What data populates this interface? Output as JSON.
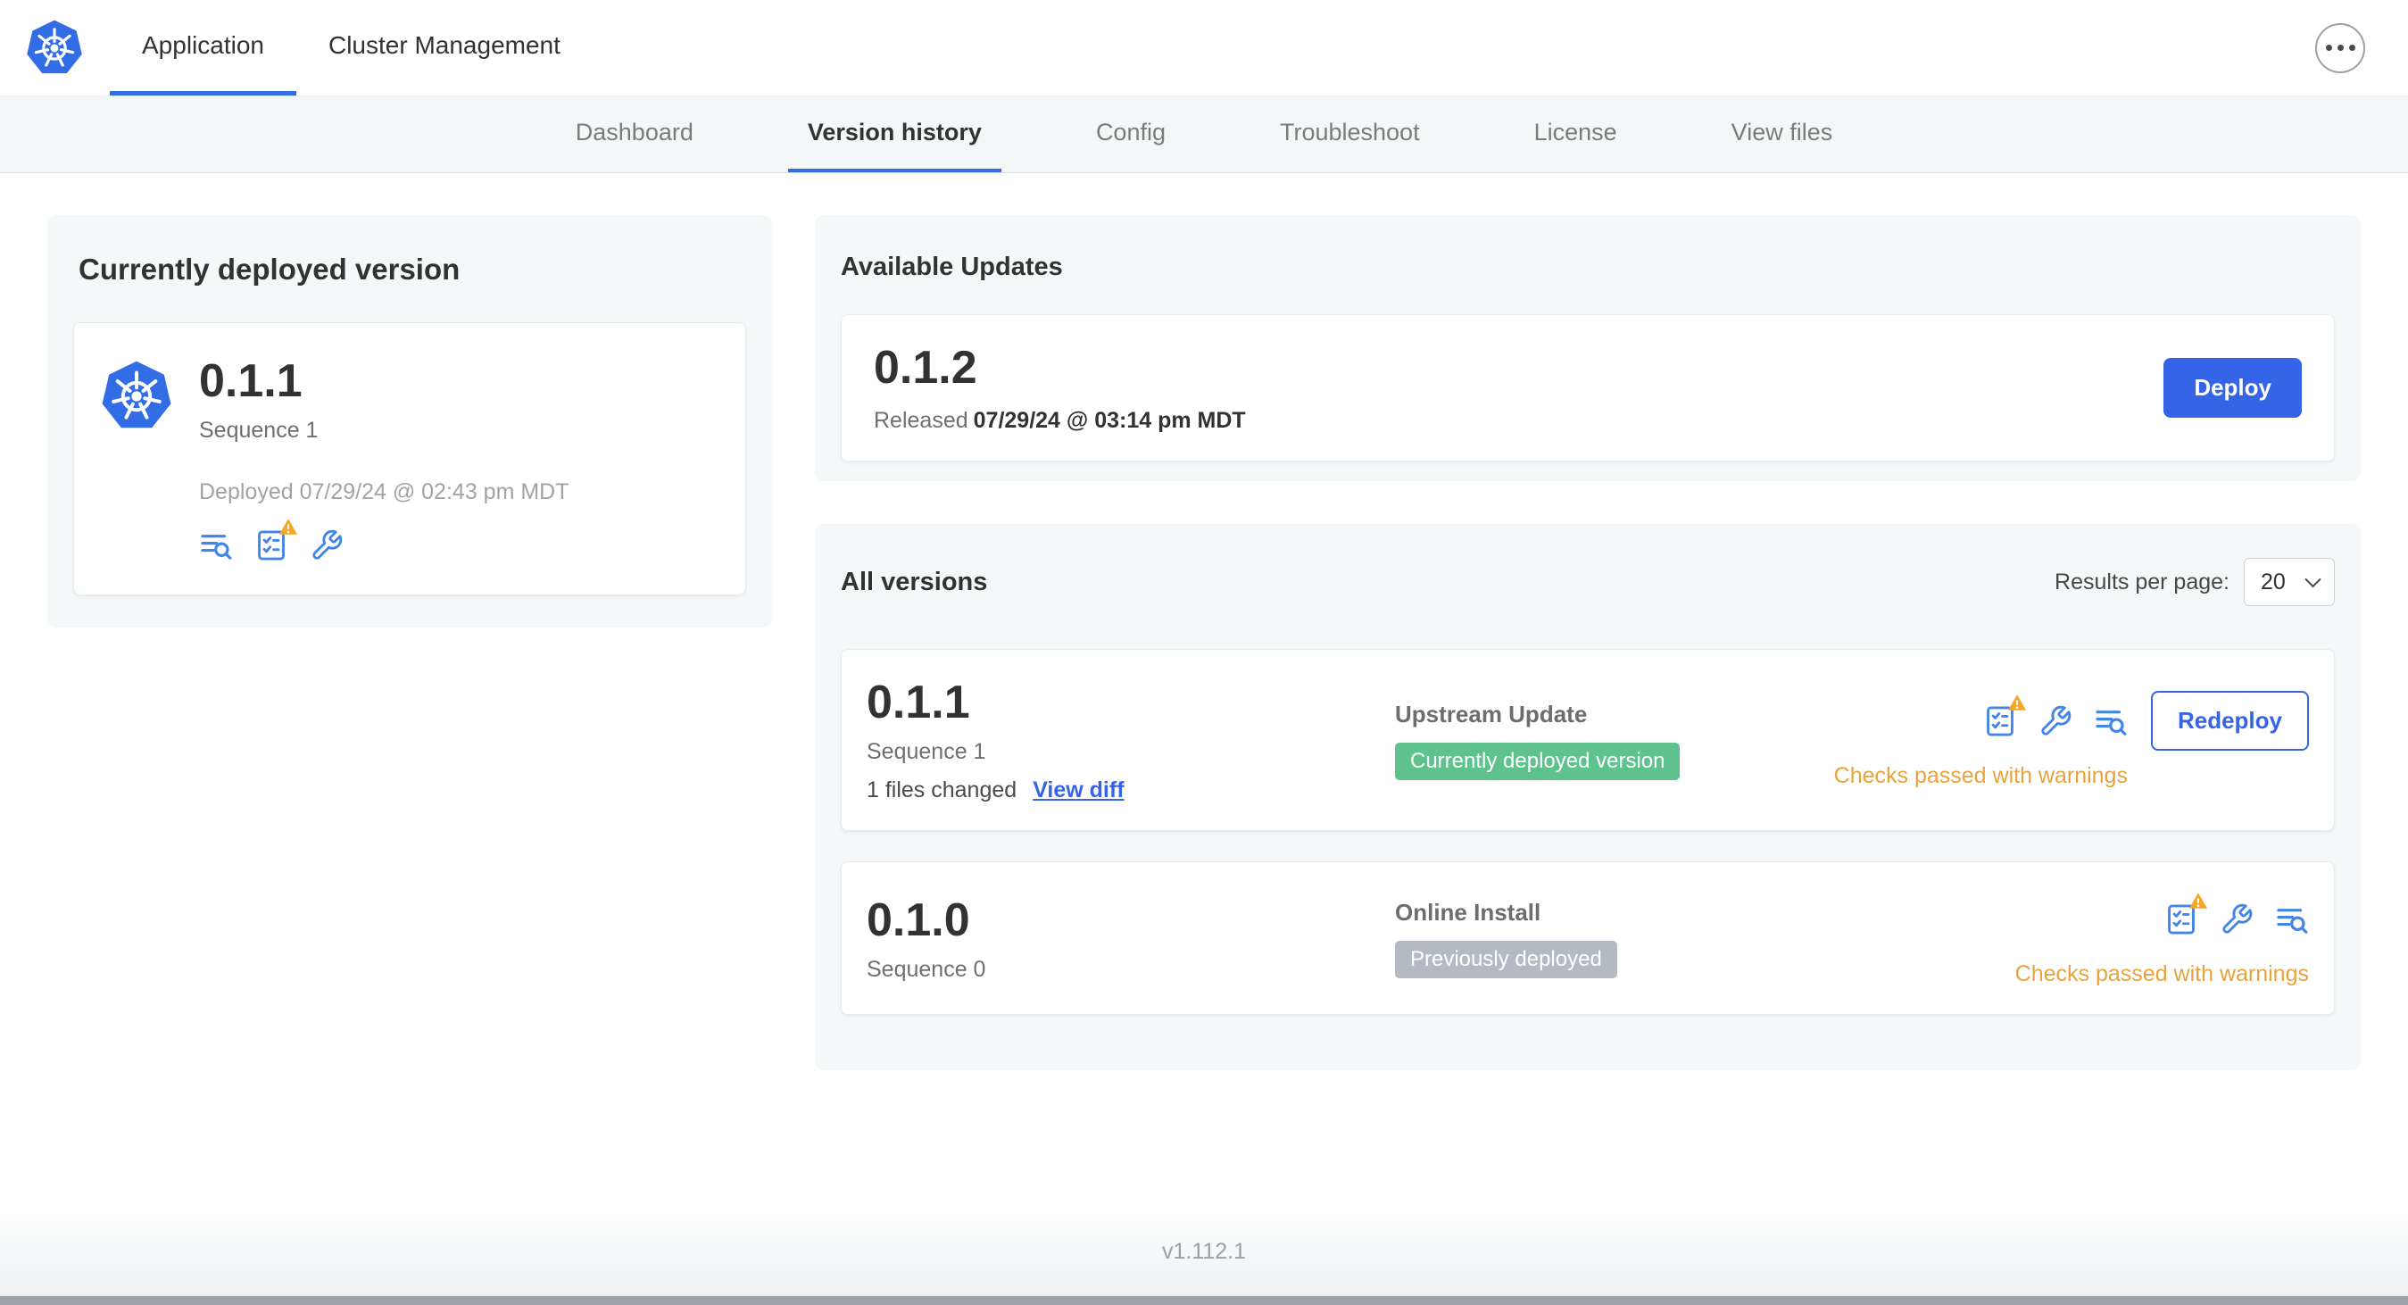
{
  "colors": {
    "primary_blue": "#3565e6",
    "k8s_blue": "#326de6",
    "icon_blue": "#4285e8",
    "warning_text": "#e8a33d",
    "warning_triangle": "#f5a623",
    "badge_green": "#5ec28f",
    "badge_gray": "#b2bac3"
  },
  "top_nav": {
    "logo_icon": "kubernetes-logo-icon",
    "overflow_icon": "ellipsis-icon",
    "tabs": [
      {
        "label": "Application",
        "active": true
      },
      {
        "label": "Cluster Management",
        "active": false
      }
    ]
  },
  "sub_nav": {
    "tabs": [
      {
        "label": "Dashboard",
        "active": false
      },
      {
        "label": "Version history",
        "active": true
      },
      {
        "label": "Config",
        "active": false
      },
      {
        "label": "Troubleshoot",
        "active": false
      },
      {
        "label": "License",
        "active": false
      },
      {
        "label": "View files",
        "active": false
      }
    ]
  },
  "deployed_card": {
    "title": "Currently deployed version",
    "version": "0.1.1",
    "sequence": "Sequence 1",
    "deployed_at": "Deployed 07/29/24 @ 02:43 pm MDT",
    "icons": [
      "logs-icon",
      "preflight-checks-warning-icon",
      "config-icon"
    ]
  },
  "available_updates": {
    "title": "Available Updates",
    "version": "0.1.2",
    "released_label": "Released",
    "released_at": "07/29/24 @ 03:14 pm MDT",
    "deploy_button": "Deploy"
  },
  "all_versions": {
    "title": "All versions",
    "results_per_page_label": "Results per page:",
    "results_per_page_value": "20",
    "rows": [
      {
        "version": "0.1.1",
        "sequence": "Sequence 1",
        "files_changed": "1 files changed",
        "view_diff_link": "View diff",
        "source": "Upstream Update",
        "badge": "Currently deployed version",
        "badge_color": "green",
        "action_button": "Redeploy",
        "status": "Checks passed with warnings",
        "icons": [
          "preflight-checks-warning-icon",
          "config-icon",
          "logs-icon"
        ]
      },
      {
        "version": "0.1.0",
        "sequence": "Sequence 0",
        "source": "Online Install",
        "badge": "Previously deployed",
        "badge_color": "gray",
        "status": "Checks passed with warnings",
        "icons": [
          "preflight-checks-warning-icon",
          "config-icon",
          "logs-icon"
        ]
      }
    ]
  },
  "footer": {
    "app_version": "v1.112.1"
  }
}
